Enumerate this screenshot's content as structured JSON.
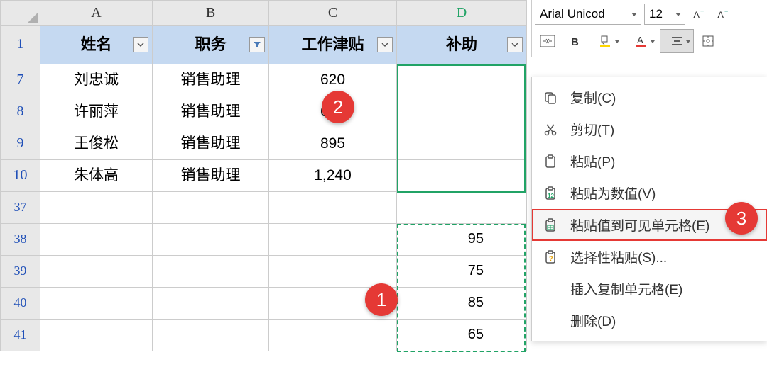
{
  "columns": [
    "A",
    "B",
    "C",
    "D"
  ],
  "header_row_num": "1",
  "headers": {
    "A": "姓名",
    "B": "职务",
    "C": "工作津贴",
    "D": "补助"
  },
  "rows": [
    {
      "num": "7",
      "A": "刘忠诚",
      "B": "销售助理",
      "C": "620",
      "D": ""
    },
    {
      "num": "8",
      "A": "许丽萍",
      "B": "销售助理",
      "C": "645",
      "D": ""
    },
    {
      "num": "9",
      "A": "王俊松",
      "B": "销售助理",
      "C": "895",
      "D": ""
    },
    {
      "num": "10",
      "A": "朱体高",
      "B": "销售助理",
      "C": "1,240",
      "D": ""
    }
  ],
  "empty_rows": [
    "37",
    "38",
    "39",
    "40",
    "41"
  ],
  "clipboard_cells": [
    "95",
    "75",
    "85",
    "65"
  ],
  "toolbar": {
    "font_name": "Arial Unicod",
    "font_size": "12"
  },
  "context_menu": {
    "copy": "复制(C)",
    "cut": "剪切(T)",
    "paste": "粘贴(P)",
    "paste_values": "粘贴为数值(V)",
    "paste_visible": "粘贴值到可见单元格(E)",
    "paste_special": "选择性粘贴(S)...",
    "insert_copied": "插入复制单元格(E)",
    "delete": "删除(D)"
  },
  "callouts": {
    "one": "1",
    "two": "2",
    "three": "3"
  }
}
